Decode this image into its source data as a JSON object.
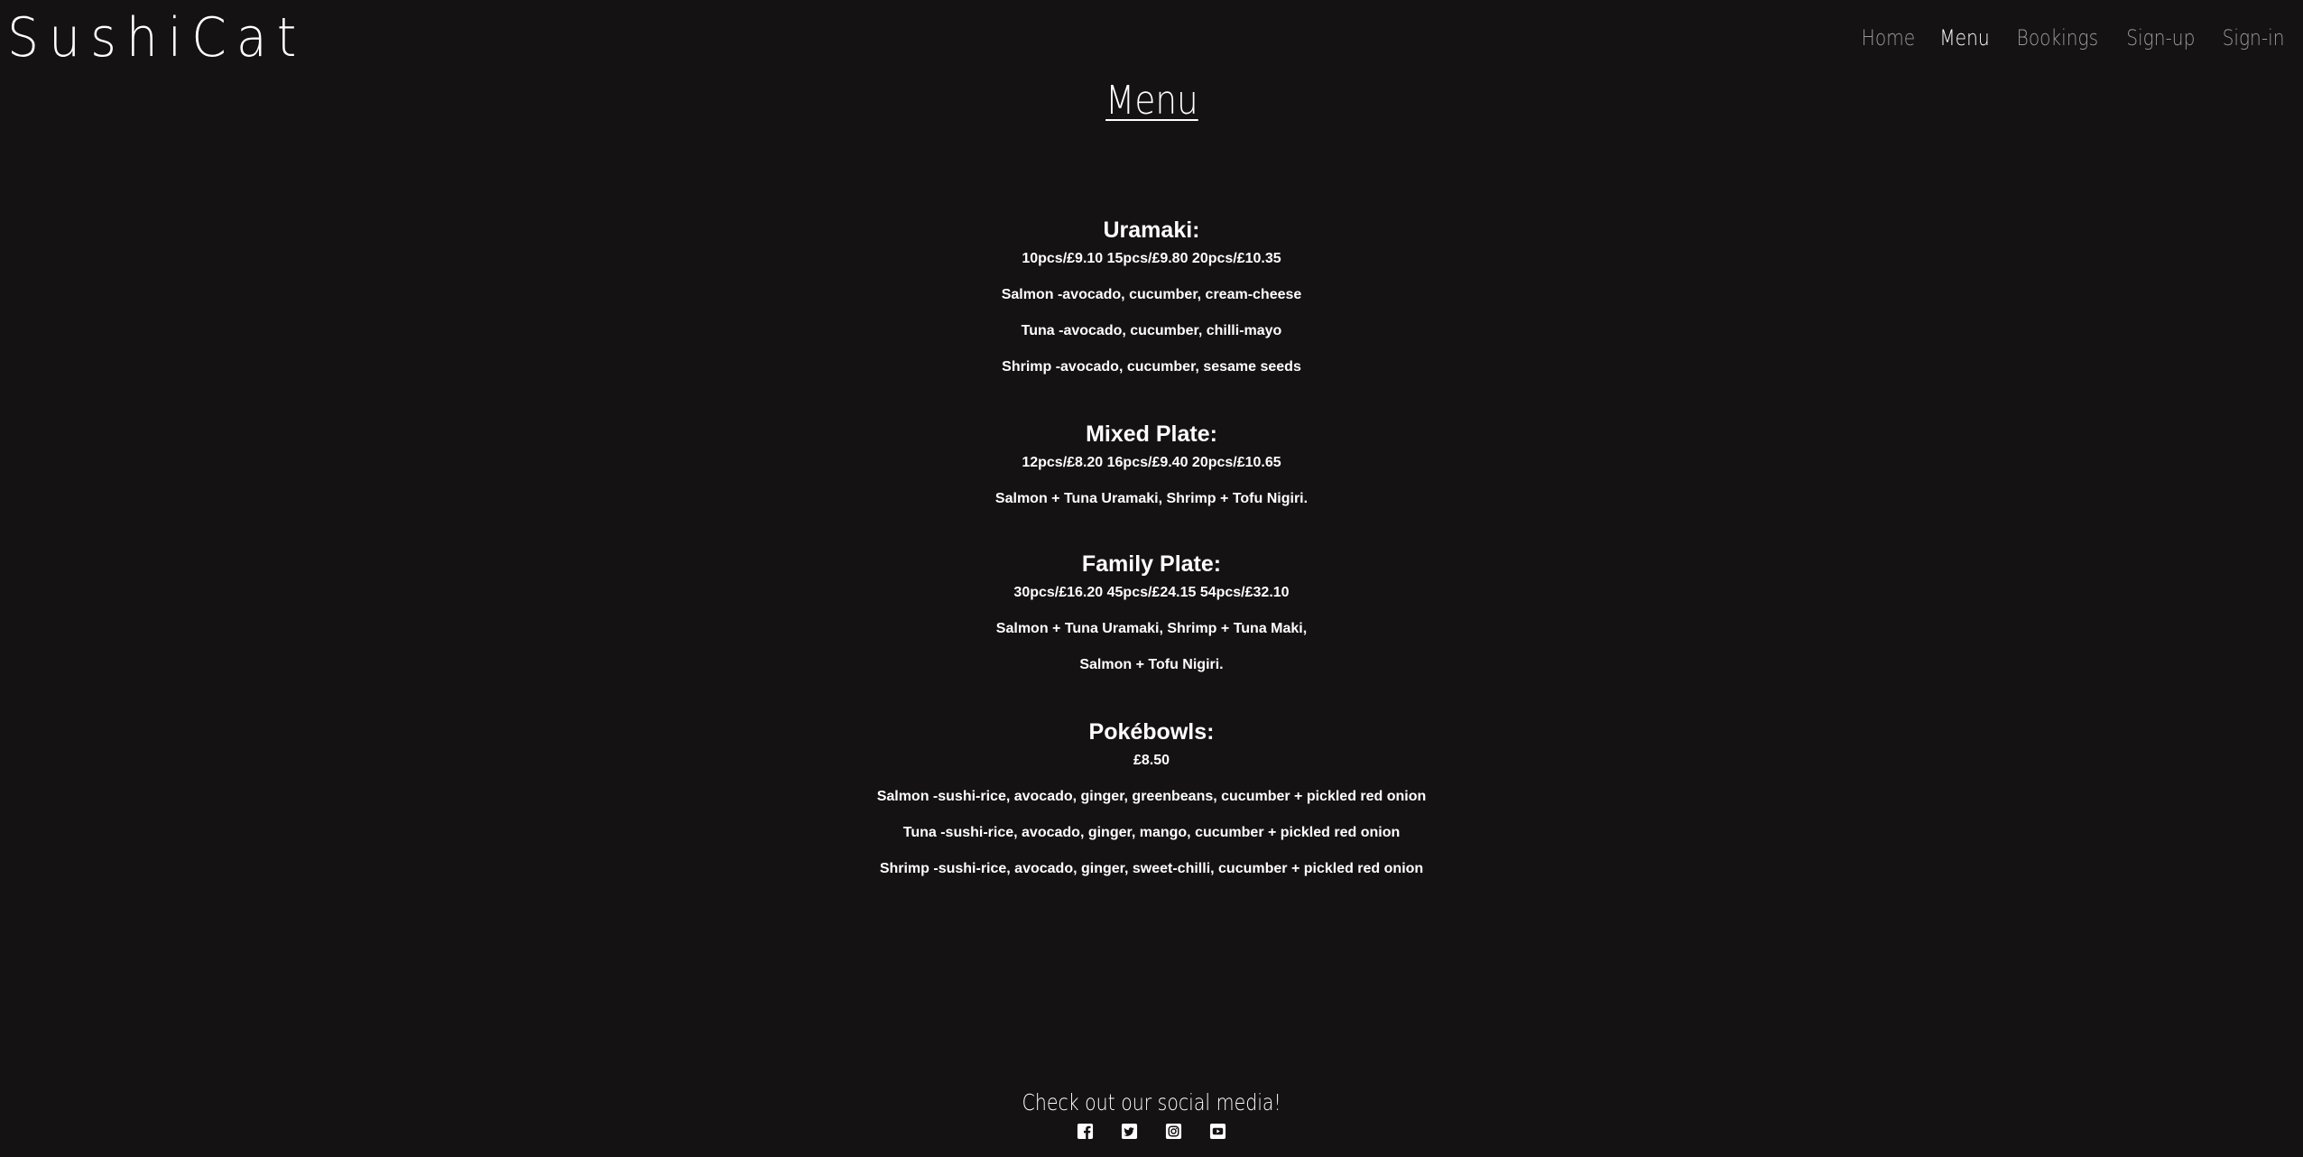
{
  "brand": {
    "name": "SushiCat"
  },
  "nav": {
    "items": [
      {
        "label": "Home"
      },
      {
        "label": "Menu"
      },
      {
        "label": "Bookings"
      },
      {
        "label": "Sign-up"
      },
      {
        "label": "Sign-in"
      }
    ],
    "active": "Menu"
  },
  "page": {
    "title": "Menu"
  },
  "menu": {
    "sections": [
      {
        "title": "Uramaki:",
        "price": "10pcs/£9.10 15pcs/£9.80 20pcs/£10.35",
        "items": [
          "Salmon -avocado, cucumber, cream-cheese",
          "Tuna -avocado, cucumber, chilli-mayo",
          "Shrimp -avocado, cucumber, sesame seeds"
        ]
      },
      {
        "title": "Mixed Plate:",
        "price": "12pcs/£8.20 16pcs/£9.40 20pcs/£10.65",
        "items": [
          "Salmon + Tuna Uramaki, Shrimp + Tofu Nigiri."
        ]
      },
      {
        "title": "Family Plate:",
        "price": "30pcs/£16.20 45pcs/£24.15 54pcs/£32.10",
        "items": [
          "Salmon + Tuna Uramaki, Shrimp + Tuna Maki,",
          "Salmon + Tofu Nigiri."
        ]
      },
      {
        "title": "Pokébowls:",
        "price": "£8.50",
        "items": [
          "Salmon -sushi-rice, avocado, ginger, greenbeans, cucumber + pickled red onion",
          "Tuna -sushi-rice, avocado, ginger, mango, cucumber + pickled red onion",
          "Shrimp -sushi-rice, avocado, ginger, sweet-chilli, cucumber + pickled red onion"
        ]
      }
    ]
  },
  "footer": {
    "text": "Check out our social media!",
    "socials": [
      {
        "icon": "facebook-icon"
      },
      {
        "icon": "twitter-icon"
      },
      {
        "icon": "instagram-icon"
      },
      {
        "icon": "youtube-icon"
      }
    ]
  },
  "colors": {
    "background": "#141213",
    "text": "#ffffff",
    "nav_inactive": "#9a9a9a"
  }
}
